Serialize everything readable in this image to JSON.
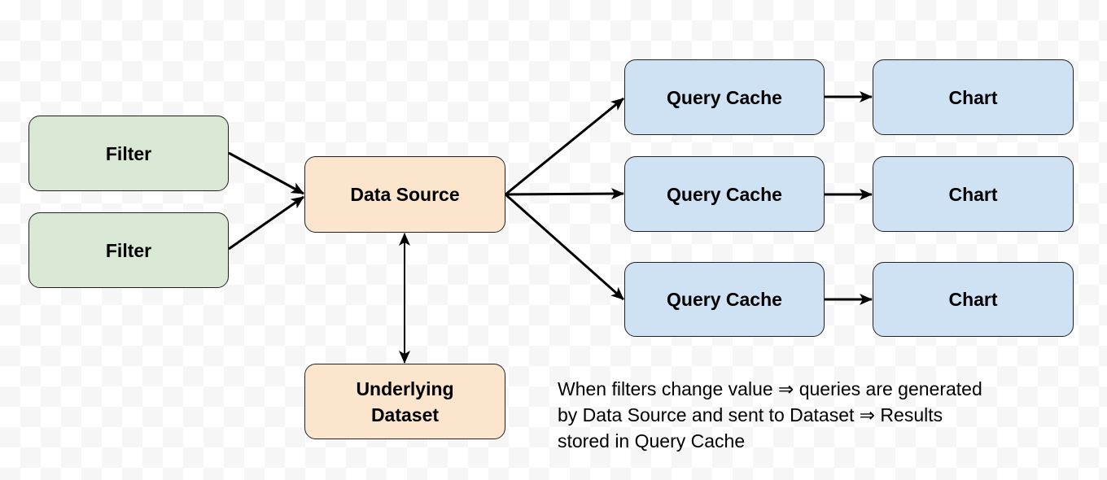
{
  "colors": {
    "filter": "#d9e8d4",
    "source": "#fce5cd",
    "cache": "#cfe2f3",
    "arrow": "#000000"
  },
  "nodes": {
    "filter1": "Filter",
    "filter2": "Filter",
    "data_source": "Data Source",
    "dataset_line1": "Underlying",
    "dataset_line2": "Dataset",
    "cache1": "Query Cache",
    "cache2": "Query Cache",
    "cache3": "Query Cache",
    "chart1": "Chart",
    "chart2": "Chart",
    "chart3": "Chart"
  },
  "edges": [
    [
      "filter1",
      "data_source"
    ],
    [
      "filter2",
      "data_source"
    ],
    [
      "data_source",
      "cache1"
    ],
    [
      "data_source",
      "cache2"
    ],
    [
      "data_source",
      "cache3"
    ],
    [
      "data_source",
      "dataset",
      "bidirectional"
    ],
    [
      "cache1",
      "chart1"
    ],
    [
      "cache2",
      "chart2"
    ],
    [
      "cache3",
      "chart3"
    ]
  ],
  "note": {
    "line1": "When filters change value ⇒ queries are generated",
    "line2": "by Data Source and sent to Dataset ⇒ Results",
    "line3": "stored in Query Cache"
  }
}
